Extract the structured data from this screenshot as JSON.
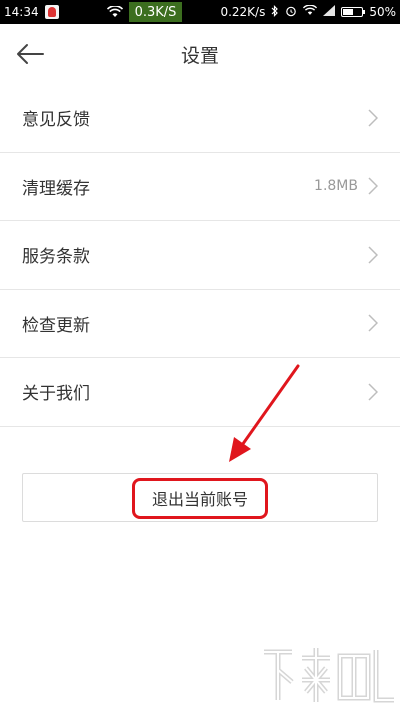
{
  "status_bar": {
    "time": "14:34",
    "net_speed_left": "0.3K/S",
    "net_speed_right": "0.22K/s",
    "battery": "50%"
  },
  "header": {
    "title": "设置"
  },
  "menu": {
    "items": [
      {
        "label": "意见反馈",
        "value": ""
      },
      {
        "label": "清理缓存",
        "value": "1.8MB"
      },
      {
        "label": "服务条款",
        "value": ""
      },
      {
        "label": "检查更新",
        "value": ""
      },
      {
        "label": "关于我们",
        "value": ""
      }
    ]
  },
  "logout": {
    "label": "退出当前账号"
  },
  "colors": {
    "highlight": "#e0161d",
    "divider": "#e6e6e6",
    "text": "#333333",
    "muted": "#999999"
  }
}
